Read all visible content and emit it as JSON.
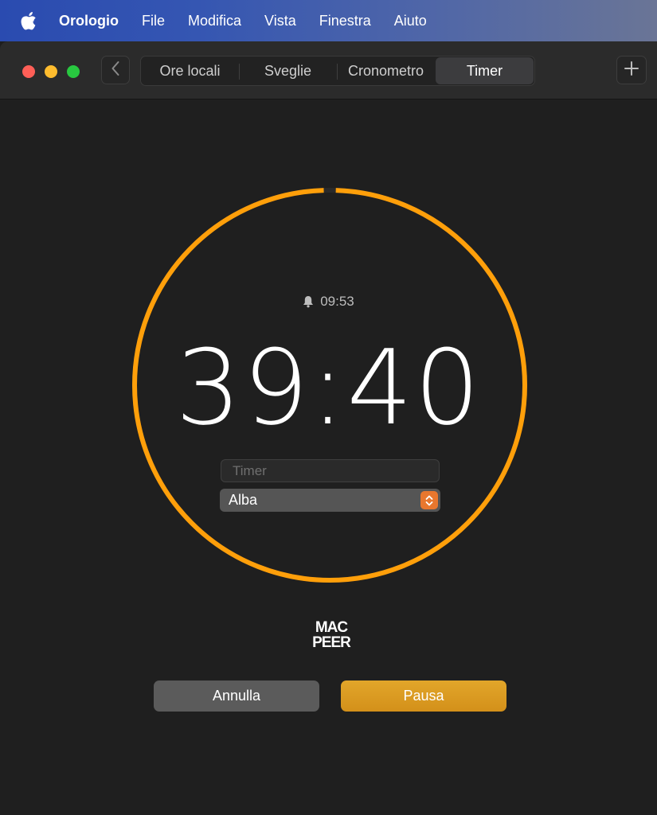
{
  "menubar": {
    "app_name": "Orologio",
    "items": [
      "File",
      "Modifica",
      "Vista",
      "Finestra",
      "Aiuto"
    ]
  },
  "tabs": [
    {
      "label": "Ore locali",
      "active": false
    },
    {
      "label": "Sveglie",
      "active": false
    },
    {
      "label": "Cronometro",
      "active": false
    },
    {
      "label": "Timer",
      "active": true
    }
  ],
  "timer": {
    "alarm_time": "09:53",
    "remaining": "39:40",
    "progress_remaining_fraction": 0.99,
    "label_placeholder": "Timer",
    "label_value": "",
    "sound": "Alba"
  },
  "logo_text": "MAC PEER",
  "buttons": {
    "cancel": "Annulla",
    "pause": "Pausa"
  },
  "colors": {
    "accent_orange": "#FF9F0A",
    "pause_button": "#D99A1F",
    "cancel_button": "#5B5B5B",
    "stepper": "#E8772E"
  },
  "icons": {
    "apple": "apple-logo",
    "back": "chevron-left",
    "add": "plus",
    "alarm": "bell",
    "stepper": "chevron-up-down"
  }
}
